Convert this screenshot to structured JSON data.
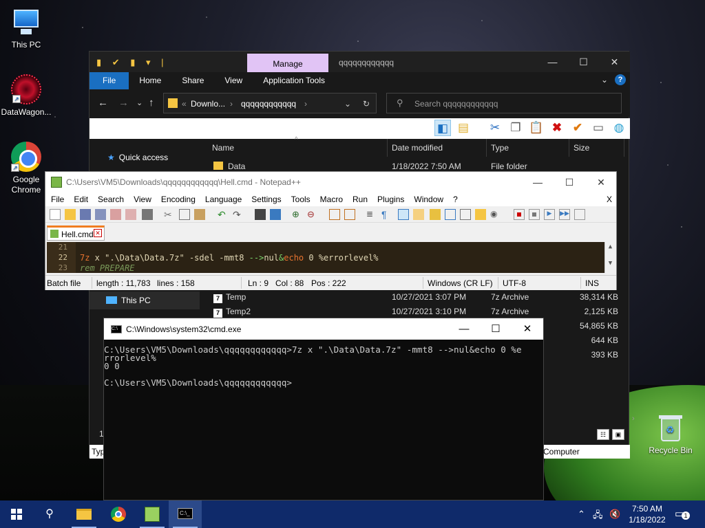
{
  "desktop": {
    "icons": [
      {
        "label": "This PC"
      },
      {
        "label": "DataWagon..."
      },
      {
        "label": "Google Chrome"
      },
      {
        "label": "Recycle Bin"
      }
    ]
  },
  "explorer": {
    "manage_tab": "Manage",
    "window_title": "qqqqqqqqqqqq",
    "ribbon_tabs": [
      "File",
      "Home",
      "Share",
      "View",
      "Application Tools"
    ],
    "address": {
      "crumb1": "Downlo...",
      "crumb2": "qqqqqqqqqqqq"
    },
    "search_placeholder": "Search qqqqqqqqqqqq",
    "nav": {
      "quick_access": "Quick access",
      "this_pc": "This PC"
    },
    "columns": {
      "name": "Name",
      "date": "Date modified",
      "type": "Type",
      "size": "Size"
    },
    "rows": [
      {
        "name": "Data",
        "date": "1/18/2022 7:50 AM",
        "type": "File folder",
        "size": ""
      },
      {
        "name": "Temp",
        "date": "10/27/2021 3:07 PM",
        "type": "7z Archive",
        "size": "38,314 KB"
      },
      {
        "name": "Temp2",
        "date": "10/27/2021 3:10 PM",
        "type": "7z Archive",
        "size": "2,125 KB"
      }
    ],
    "extra_sizes": [
      "54,865 KB",
      "644 KB",
      "393 KB"
    ],
    "status_left": "Typ",
    "status_right": "Computer",
    "partial_number": "1"
  },
  "notepadpp": {
    "title": "C:\\Users\\VM5\\Downloads\\qqqqqqqqqqqq\\Hell.cmd - Notepad++",
    "menu": [
      "File",
      "Edit",
      "Search",
      "View",
      "Encoding",
      "Language",
      "Settings",
      "Tools",
      "Macro",
      "Run",
      "Plugins",
      "Window",
      "?"
    ],
    "close_x": "X",
    "tab_label": "Hell.cmd",
    "lines": [
      {
        "num": "21",
        "text": ""
      },
      {
        "num": "22",
        "text": "7z x \".\\Data\\Data.7z\" -sdel -mmt8 -->nul&echo 0 %errorlevel%"
      },
      {
        "num": "23",
        "text": "rem PREPARE"
      }
    ],
    "status": {
      "filetype": "Batch file",
      "length": "length : 11,783",
      "lines": "lines : 158",
      "ln": "Ln : 9",
      "col": "Col : 88",
      "pos": "Pos : 222",
      "eol": "Windows (CR LF)",
      "encoding": "UTF-8",
      "mode": "INS"
    },
    "colors": {
      "editor_bg": "#2b2214",
      "keyword": "#e8742f",
      "string": "#e0d6b4",
      "operator": "#7bd36a",
      "comment": "#7a9a5a"
    }
  },
  "cmd": {
    "title": "C:\\Windows\\system32\\cmd.exe",
    "lines": [
      "C:\\Users\\VM5\\Downloads\\qqqqqqqqqqqq>7z x \".\\Data\\Data.7z\" -mmt8 -->nul&echo 0 %e",
      "rrorlevel%",
      "0 0",
      "",
      "C:\\Users\\VM5\\Downloads\\qqqqqqqqqqqq>"
    ]
  },
  "taskbar": {
    "time": "7:50 AM",
    "date": "1/18/2022",
    "notification_count": "1"
  }
}
